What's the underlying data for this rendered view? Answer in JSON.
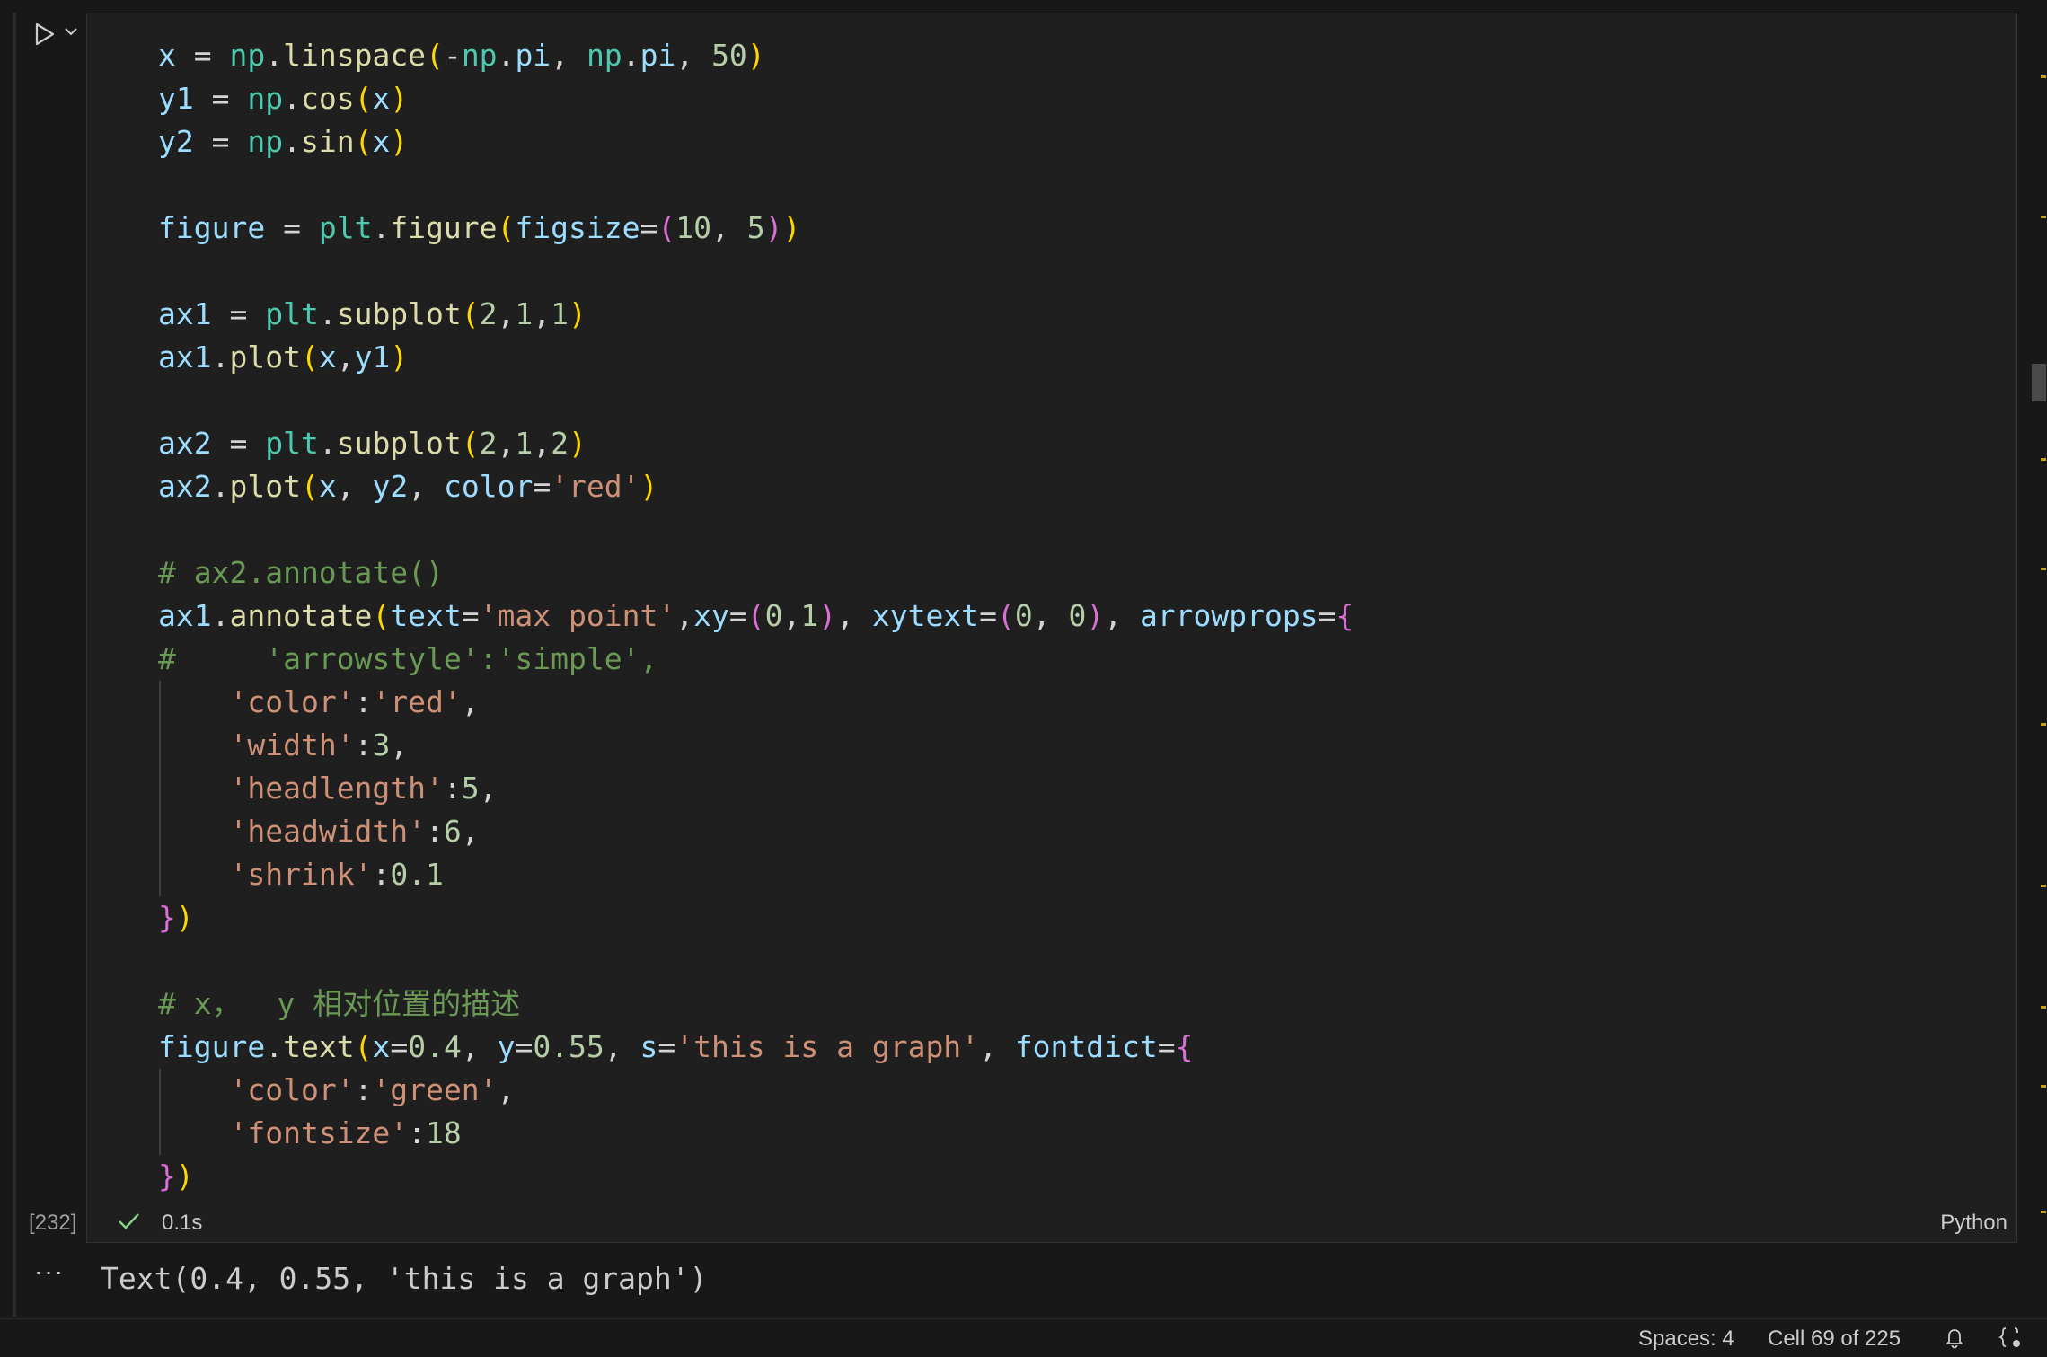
{
  "cell": {
    "execution_count": "[232]",
    "duration": "0.1s",
    "language": "Python",
    "code_lines": [
      [
        [
          "v",
          "x"
        ],
        [
          "o",
          " = "
        ],
        [
          "m",
          "np"
        ],
        [
          "o",
          "."
        ],
        [
          "f",
          "linspace"
        ],
        [
          "p1",
          "("
        ],
        [
          "o",
          "-"
        ],
        [
          "m",
          "np"
        ],
        [
          "o",
          "."
        ],
        [
          "v",
          "pi"
        ],
        [
          "o",
          ", "
        ],
        [
          "m",
          "np"
        ],
        [
          "o",
          "."
        ],
        [
          "v",
          "pi"
        ],
        [
          "o",
          ", "
        ],
        [
          "n",
          "50"
        ],
        [
          "p1",
          ")"
        ]
      ],
      [
        [
          "v",
          "y1"
        ],
        [
          "o",
          " = "
        ],
        [
          "m",
          "np"
        ],
        [
          "o",
          "."
        ],
        [
          "f",
          "cos"
        ],
        [
          "p1",
          "("
        ],
        [
          "v",
          "x"
        ],
        [
          "p1",
          ")"
        ]
      ],
      [
        [
          "v",
          "y2"
        ],
        [
          "o",
          " = "
        ],
        [
          "m",
          "np"
        ],
        [
          "o",
          "."
        ],
        [
          "f",
          "sin"
        ],
        [
          "p1",
          "("
        ],
        [
          "v",
          "x"
        ],
        [
          "p1",
          ")"
        ]
      ],
      [],
      [
        [
          "v",
          "figure"
        ],
        [
          "o",
          " = "
        ],
        [
          "m",
          "plt"
        ],
        [
          "o",
          "."
        ],
        [
          "f",
          "figure"
        ],
        [
          "p1",
          "("
        ],
        [
          "v",
          "figsize"
        ],
        [
          "o",
          "="
        ],
        [
          "p2",
          "("
        ],
        [
          "n",
          "10"
        ],
        [
          "o",
          ", "
        ],
        [
          "n",
          "5"
        ],
        [
          "p2",
          ")"
        ],
        [
          "p1",
          ")"
        ]
      ],
      [],
      [
        [
          "v",
          "ax1"
        ],
        [
          "o",
          " = "
        ],
        [
          "m",
          "plt"
        ],
        [
          "o",
          "."
        ],
        [
          "f",
          "subplot"
        ],
        [
          "p1",
          "("
        ],
        [
          "n",
          "2"
        ],
        [
          "o",
          ","
        ],
        [
          "n",
          "1"
        ],
        [
          "o",
          ","
        ],
        [
          "n",
          "1"
        ],
        [
          "p1",
          ")"
        ]
      ],
      [
        [
          "v",
          "ax1"
        ],
        [
          "o",
          "."
        ],
        [
          "f",
          "plot"
        ],
        [
          "p1",
          "("
        ],
        [
          "v",
          "x"
        ],
        [
          "o",
          ","
        ],
        [
          "v",
          "y1"
        ],
        [
          "p1",
          ")"
        ]
      ],
      [],
      [
        [
          "v",
          "ax2"
        ],
        [
          "o",
          " = "
        ],
        [
          "m",
          "plt"
        ],
        [
          "o",
          "."
        ],
        [
          "f",
          "subplot"
        ],
        [
          "p1",
          "("
        ],
        [
          "n",
          "2"
        ],
        [
          "o",
          ","
        ],
        [
          "n",
          "1"
        ],
        [
          "o",
          ","
        ],
        [
          "n",
          "2"
        ],
        [
          "p1",
          ")"
        ]
      ],
      [
        [
          "v",
          "ax2"
        ],
        [
          "o",
          "."
        ],
        [
          "f",
          "plot"
        ],
        [
          "p1",
          "("
        ],
        [
          "v",
          "x"
        ],
        [
          "o",
          ", "
        ],
        [
          "v",
          "y2"
        ],
        [
          "o",
          ", "
        ],
        [
          "v",
          "color"
        ],
        [
          "o",
          "="
        ],
        [
          "s",
          "'red'"
        ],
        [
          "p1",
          ")"
        ]
      ],
      [],
      [
        [
          "c",
          "# ax2.annotate()"
        ]
      ],
      [
        [
          "v",
          "ax1"
        ],
        [
          "o",
          "."
        ],
        [
          "f",
          "annotate"
        ],
        [
          "p1",
          "("
        ],
        [
          "v",
          "text"
        ],
        [
          "o",
          "="
        ],
        [
          "s",
          "'max point'"
        ],
        [
          "o",
          ","
        ],
        [
          "v",
          "xy"
        ],
        [
          "o",
          "="
        ],
        [
          "p2",
          "("
        ],
        [
          "n",
          "0"
        ],
        [
          "o",
          ","
        ],
        [
          "n",
          "1"
        ],
        [
          "p2",
          ")"
        ],
        [
          "o",
          ", "
        ],
        [
          "v",
          "xytext"
        ],
        [
          "o",
          "="
        ],
        [
          "p2",
          "("
        ],
        [
          "n",
          "0"
        ],
        [
          "o",
          ", "
        ],
        [
          "n",
          "0"
        ],
        [
          "p2",
          ")"
        ],
        [
          "o",
          ", "
        ],
        [
          "v",
          "arrowprops"
        ],
        [
          "o",
          "="
        ],
        [
          "p2",
          "{"
        ]
      ],
      [
        [
          "c",
          "#     'arrowstyle':'simple',"
        ]
      ],
      [
        [
          "o",
          "    "
        ],
        [
          "s",
          "'color'"
        ],
        [
          "o",
          ":"
        ],
        [
          "s",
          "'red'"
        ],
        [
          "o",
          ","
        ]
      ],
      [
        [
          "o",
          "    "
        ],
        [
          "s",
          "'width'"
        ],
        [
          "o",
          ":"
        ],
        [
          "n",
          "3"
        ],
        [
          "o",
          ","
        ]
      ],
      [
        [
          "o",
          "    "
        ],
        [
          "s",
          "'headlength'"
        ],
        [
          "o",
          ":"
        ],
        [
          "n",
          "5"
        ],
        [
          "o",
          ","
        ]
      ],
      [
        [
          "o",
          "    "
        ],
        [
          "s",
          "'headwidth'"
        ],
        [
          "o",
          ":"
        ],
        [
          "n",
          "6"
        ],
        [
          "o",
          ","
        ]
      ],
      [
        [
          "o",
          "    "
        ],
        [
          "s",
          "'shrink'"
        ],
        [
          "o",
          ":"
        ],
        [
          "n",
          "0.1"
        ]
      ],
      [
        [
          "p2",
          "}"
        ],
        [
          "p1",
          ")"
        ]
      ],
      [],
      [
        [
          "c",
          "# x，  y 相对位置的描述"
        ]
      ],
      [
        [
          "v",
          "figure"
        ],
        [
          "o",
          "."
        ],
        [
          "f",
          "text"
        ],
        [
          "p1",
          "("
        ],
        [
          "v",
          "x"
        ],
        [
          "o",
          "="
        ],
        [
          "n",
          "0.4"
        ],
        [
          "o",
          ", "
        ],
        [
          "v",
          "y"
        ],
        [
          "o",
          "="
        ],
        [
          "n",
          "0.55"
        ],
        [
          "o",
          ", "
        ],
        [
          "v",
          "s"
        ],
        [
          "o",
          "="
        ],
        [
          "s",
          "'this is a graph'"
        ],
        [
          "o",
          ", "
        ],
        [
          "v",
          "fontdict"
        ],
        [
          "o",
          "="
        ],
        [
          "p2",
          "{"
        ]
      ],
      [
        [
          "o",
          "    "
        ],
        [
          "s",
          "'color'"
        ],
        [
          "o",
          ":"
        ],
        [
          "s",
          "'green'"
        ],
        [
          "o",
          ","
        ]
      ],
      [
        [
          "o",
          "    "
        ],
        [
          "s",
          "'fontsize'"
        ],
        [
          "o",
          ":"
        ],
        [
          "n",
          "18"
        ]
      ],
      [
        [
          "p2",
          "}"
        ],
        [
          "p1",
          ")"
        ]
      ]
    ]
  },
  "output": {
    "more_label": "···",
    "text": "Text(0.4, 0.55, 'this is a graph')"
  },
  "statusbar": {
    "spaces": "Spaces: 4",
    "cell_position": "Cell 69 of 225"
  },
  "icons": {
    "run": "play-icon",
    "chevron": "chevron-down-icon",
    "check": "check-icon",
    "bell": "bell-icon",
    "braces": "braces-icon"
  },
  "colors": {
    "background": "#181818",
    "cell_background": "#1f1f1f",
    "success": "#89d185"
  }
}
